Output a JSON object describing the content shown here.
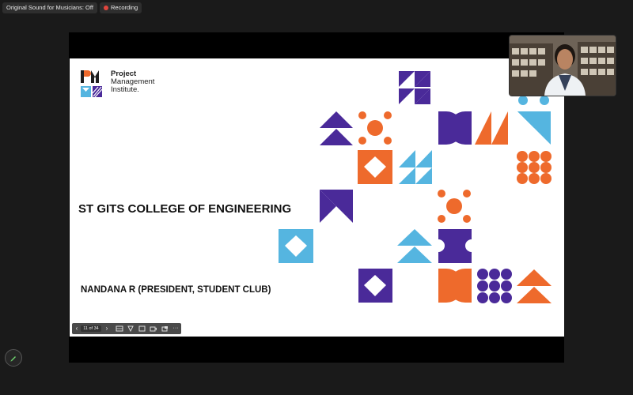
{
  "meeting": {
    "original_sound_label": "Original Sound for Musicians: Off",
    "recording_label": "Recording"
  },
  "slide": {
    "logo_lines": [
      "Project",
      "Management",
      "Institute."
    ],
    "college_name": "ST GITS COLLEGE OF ENGINEERING",
    "presenter": "NANDANA R (PRESIDENT, STUDENT CLUB)"
  },
  "toolbar": {
    "page_indicator": "11 of 34",
    "more_label": "···"
  },
  "colors": {
    "purple": "#4a2a99",
    "orange": "#ee6a2c",
    "blue": "#55b5e0",
    "recording": "#e0453d"
  },
  "icons": [
    "pencil-icon",
    "prev-slide-icon",
    "next-slide-icon",
    "grid-view-icon",
    "annotate-icon",
    "image-icon",
    "video-icon",
    "share-icon"
  ]
}
